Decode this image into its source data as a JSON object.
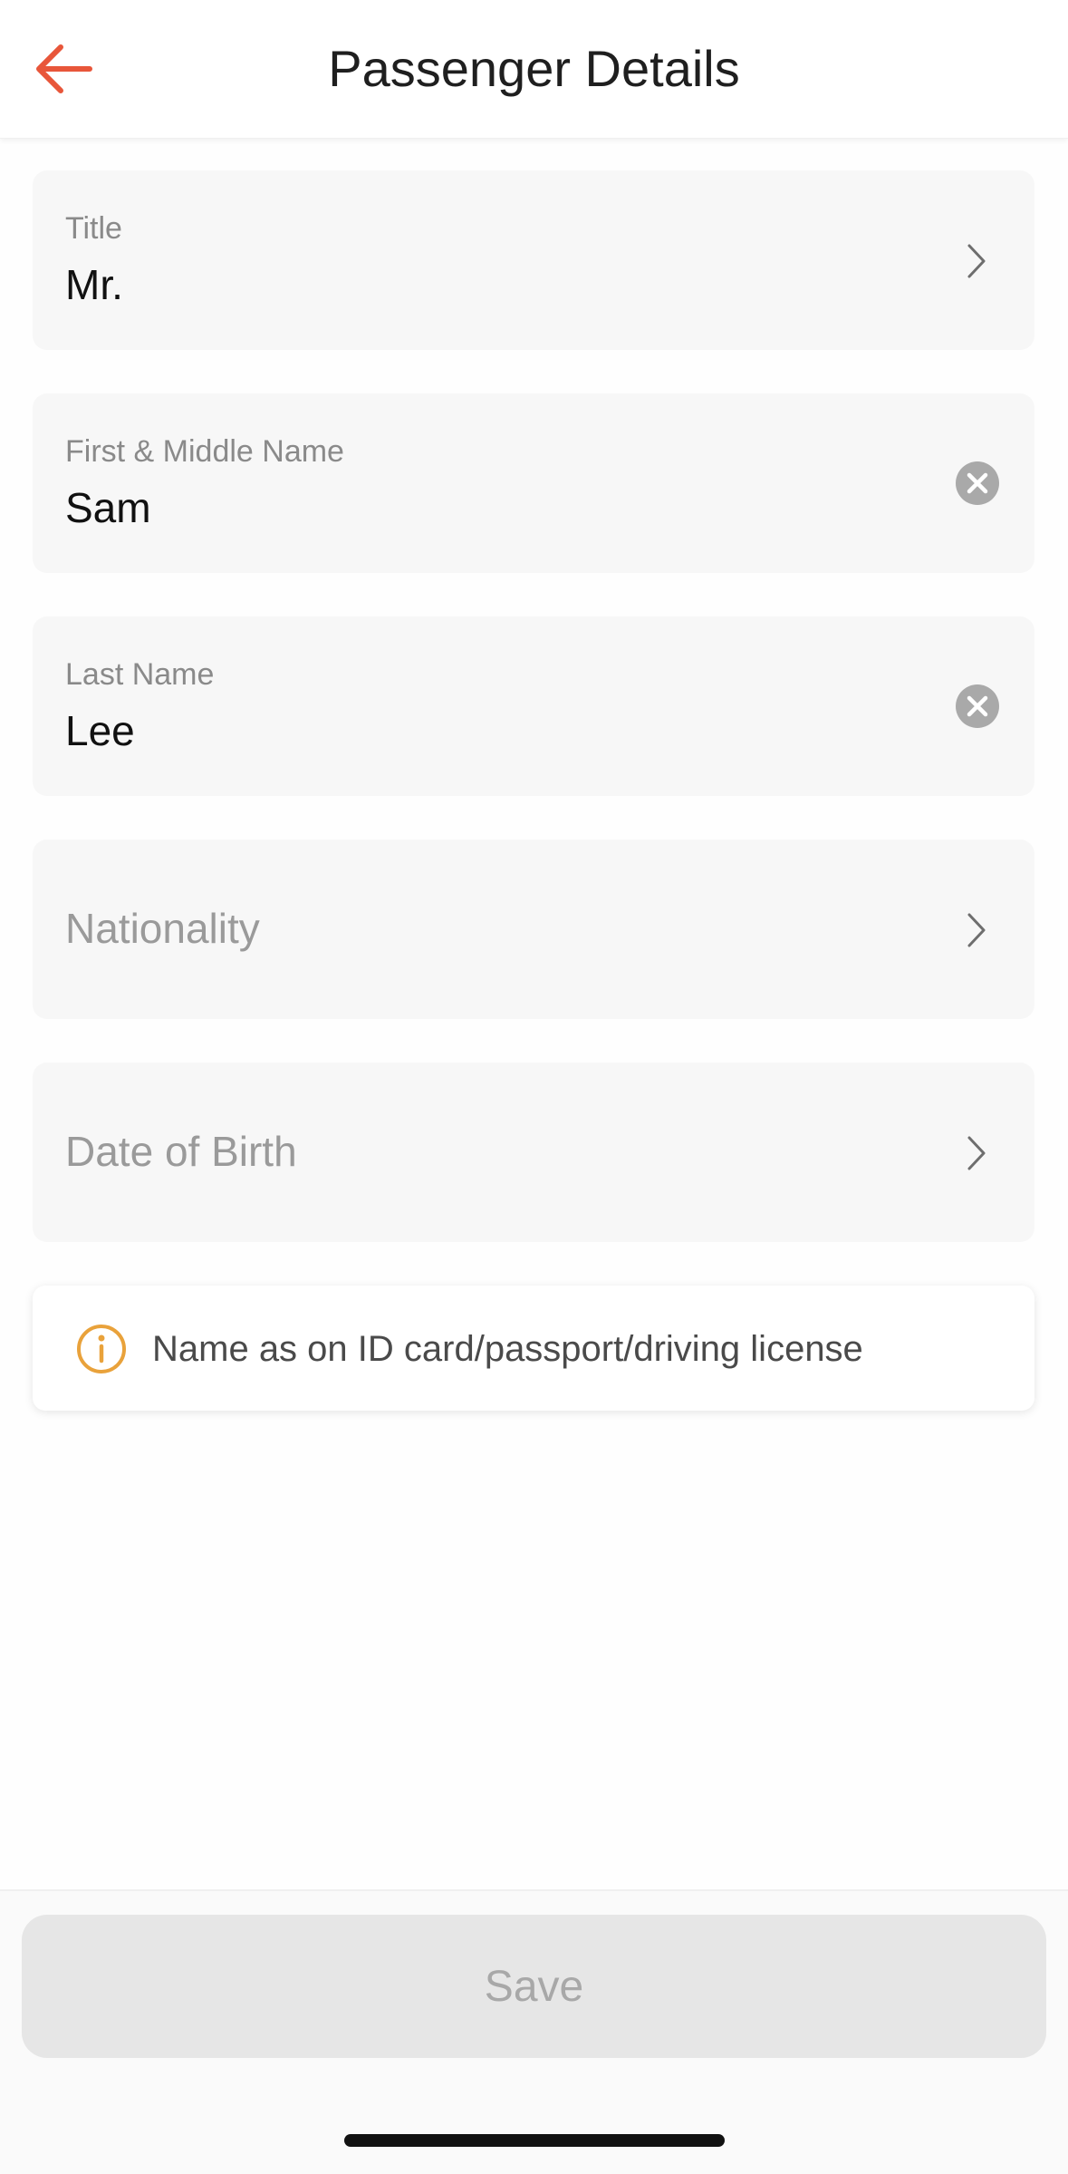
{
  "header": {
    "title": "Passenger Details",
    "back_icon": "arrow-left-icon",
    "accent_color": "#e8563a"
  },
  "fields": {
    "title": {
      "label": "Title",
      "value": "Mr."
    },
    "first_name": {
      "label": "First & Middle Name",
      "value": "Sam"
    },
    "last_name": {
      "label": "Last Name",
      "value": "Lee"
    },
    "nationality": {
      "placeholder": "Nationality"
    },
    "dob": {
      "placeholder": "Date of Birth"
    }
  },
  "info": {
    "text": "Name as on ID card/passport/driving license",
    "icon": "info-icon",
    "icon_color": "#e9a23b"
  },
  "footer": {
    "save_label": "Save"
  }
}
